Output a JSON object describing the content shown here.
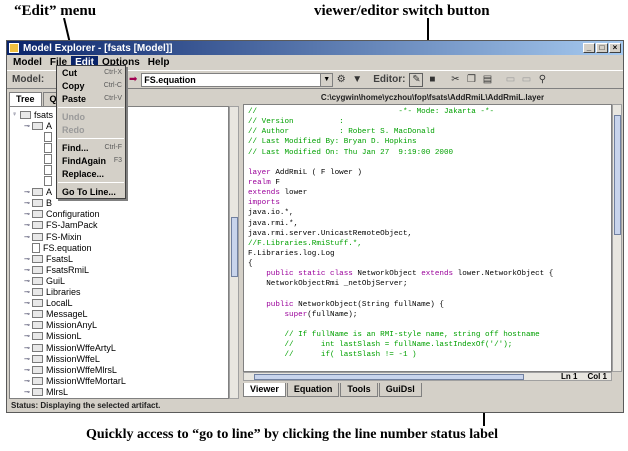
{
  "annotations": {
    "edit_menu": "“Edit” menu",
    "switch_button": "viewer/editor switch button",
    "goto_line": "Quickly access to “go to line” by clicking the line number status label"
  },
  "window": {
    "title": "Model Explorer - [fsats [Model]]",
    "controls": [
      "_",
      "□",
      "×"
    ]
  },
  "menubar": {
    "items": [
      "Model",
      "File",
      "Edit",
      "Options",
      "Help"
    ],
    "active": "Edit"
  },
  "toolbar": {
    "model_label": "Model:",
    "feature_value": "FS.equation",
    "editor_label": "Editor:"
  },
  "edit_menu": {
    "items": [
      {
        "label": "Cut",
        "shortcut": "Ctrl-X",
        "enabled": true
      },
      {
        "label": "Copy",
        "shortcut": "Ctrl-C",
        "enabled": true
      },
      {
        "label": "Paste",
        "shortcut": "Ctrl-V",
        "enabled": true
      },
      {
        "label": "Undo",
        "shortcut": "",
        "enabled": false
      },
      {
        "label": "Redo",
        "shortcut": "",
        "enabled": false
      },
      {
        "label": "Find...",
        "shortcut": "Ctrl-F",
        "enabled": true
      },
      {
        "label": "FindAgain",
        "shortcut": "F3",
        "enabled": true
      },
      {
        "label": "Replace...",
        "shortcut": "",
        "enabled": true
      },
      {
        "label": "Go To Line...",
        "shortcut": "",
        "enabled": true
      }
    ]
  },
  "left_tabs": [
    "Tree",
    "Qu"
  ],
  "tree": {
    "root": "fsats",
    "items": [
      {
        "label": "A",
        "type": "folder",
        "indent": 1
      },
      {
        "label": "",
        "type": "doc",
        "indent": 2
      },
      {
        "label": "",
        "type": "doc",
        "indent": 2
      },
      {
        "label": "",
        "type": "doc",
        "indent": 2
      },
      {
        "label": "",
        "type": "doc",
        "indent": 2
      },
      {
        "label": "",
        "type": "doc",
        "indent": 2
      },
      {
        "label": "A",
        "type": "folder",
        "indent": 1
      },
      {
        "label": "B",
        "type": "folder",
        "indent": 1
      },
      {
        "label": "Configuration",
        "type": "folder",
        "indent": 1
      },
      {
        "label": "FS-JamPack",
        "type": "folder",
        "indent": 1
      },
      {
        "label": "FS-Mixin",
        "type": "folder",
        "indent": 1
      },
      {
        "label": "FS.equation",
        "type": "doc",
        "indent": 1
      },
      {
        "label": "FsatsL",
        "type": "folder",
        "indent": 1
      },
      {
        "label": "FsatsRmiL",
        "type": "folder",
        "indent": 1
      },
      {
        "label": "GuiL",
        "type": "folder",
        "indent": 1
      },
      {
        "label": "Libraries",
        "type": "folder",
        "indent": 1
      },
      {
        "label": "LocalL",
        "type": "folder",
        "indent": 1
      },
      {
        "label": "MessageL",
        "type": "folder",
        "indent": 1
      },
      {
        "label": "MissionAnyL",
        "type": "folder",
        "indent": 1
      },
      {
        "label": "MissionL",
        "type": "folder",
        "indent": 1
      },
      {
        "label": "MissionWffeArtyL",
        "type": "folder",
        "indent": 1
      },
      {
        "label": "MissionWffeL",
        "type": "folder",
        "indent": 1
      },
      {
        "label": "MissionWffeMlrsL",
        "type": "folder",
        "indent": 1
      },
      {
        "label": "MissionWffeMortarL",
        "type": "folder",
        "indent": 1
      },
      {
        "label": "MlrsL",
        "type": "folder",
        "indent": 1
      },
      {
        "label": "ModelL",
        "type": "folder",
        "indent": 1
      }
    ]
  },
  "editor": {
    "path": "C:\\cygwin\\home\\yczhou\\fop\\fsats\\AddRmiL\\AddRmiL.layer",
    "lines": [
      [
        {
          "t": "//                               -*- Mode: Jakarta -*-",
          "c": "com"
        }
      ],
      [
        {
          "t": "// Version          :",
          "c": "com"
        }
      ],
      [
        {
          "t": "// Author           : Robert S. MacDonald",
          "c": "com"
        }
      ],
      [
        {
          "t": "// Last Modified By: Bryan D. Hopkins",
          "c": "com"
        }
      ],
      [
        {
          "t": "// Last Modified On: Thu Jan 27  9:19:00 2000",
          "c": "com"
        }
      ],
      [
        {
          "t": "",
          "c": "tx"
        }
      ],
      [
        {
          "t": "layer",
          "c": "kw"
        },
        {
          "t": " AddRmiL ( F lower )",
          "c": "tx"
        }
      ],
      [
        {
          "t": "realm",
          "c": "kw"
        },
        {
          "t": " F",
          "c": "tx"
        }
      ],
      [
        {
          "t": "extends",
          "c": "kw"
        },
        {
          "t": " lower",
          "c": "tx"
        }
      ],
      [
        {
          "t": "imports",
          "c": "kw"
        }
      ],
      [
        {
          "t": "java.io.*,",
          "c": "tx"
        }
      ],
      [
        {
          "t": "java.rmi.*,",
          "c": "tx"
        }
      ],
      [
        {
          "t": "java.rmi.server.UnicastRemoteObject,",
          "c": "tx"
        }
      ],
      [
        {
          "t": "//F.Libraries.RmiStuff.*,",
          "c": "com"
        }
      ],
      [
        {
          "t": "F.Libraries.log.Log",
          "c": "tx"
        }
      ],
      [
        {
          "t": "{",
          "c": "tx"
        }
      ],
      [
        {
          "t": "    ",
          "c": "tx"
        },
        {
          "t": "public static class",
          "c": "kw"
        },
        {
          "t": " NetworkObject ",
          "c": "tx"
        },
        {
          "t": "extends",
          "c": "kw"
        },
        {
          "t": " lower.NetworkObject {",
          "c": "tx"
        }
      ],
      [
        {
          "t": "    NetworkObjectRmi _netObjServer;",
          "c": "tx"
        }
      ],
      [
        {
          "t": "",
          "c": "tx"
        }
      ],
      [
        {
          "t": "    ",
          "c": "tx"
        },
        {
          "t": "public",
          "c": "kw"
        },
        {
          "t": " NetworkObject(String fullName) {",
          "c": "tx"
        }
      ],
      [
        {
          "t": "        ",
          "c": "tx"
        },
        {
          "t": "super",
          "c": "kw"
        },
        {
          "t": "(fullName);",
          "c": "tx"
        }
      ],
      [
        {
          "t": "",
          "c": "tx"
        }
      ],
      [
        {
          "t": "        // If fullName is an RMI-style name, string off hostname",
          "c": "com"
        }
      ],
      [
        {
          "t": "        //      int lastSlash = fullName.lastIndexOf('/');",
          "c": "com"
        }
      ],
      [
        {
          "t": "        //      if( lastSlash != -1 )",
          "c": "com"
        }
      ]
    ]
  },
  "editor_status": {
    "line": "Ln 1",
    "col": "Col 1"
  },
  "bottom_tabs": [
    "Viewer",
    "Equation",
    "Tools",
    "GuiDsl"
  ],
  "status_text": "Status: Displaying the selected artifact."
}
